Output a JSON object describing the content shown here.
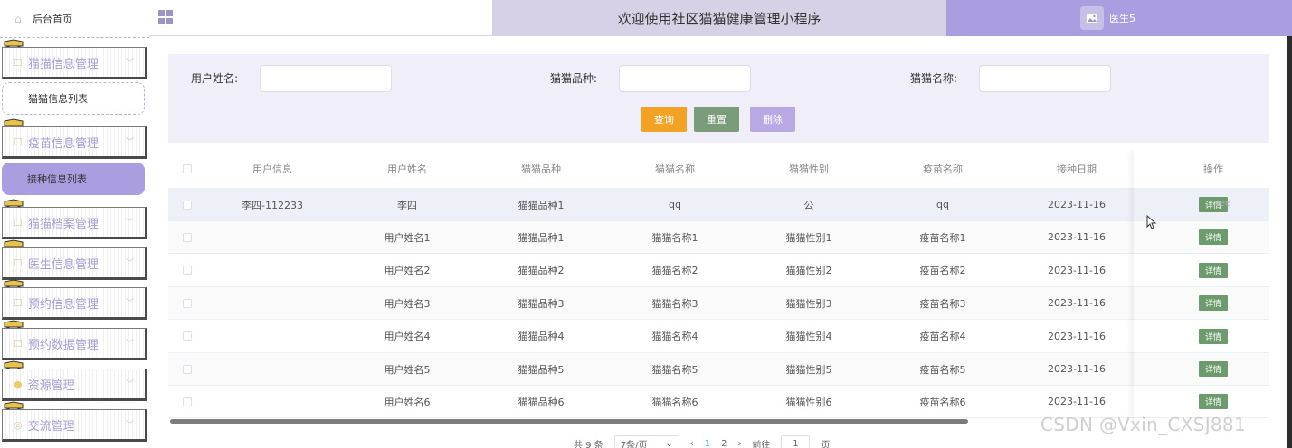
{
  "sidebar": {
    "home_label": "后台首页",
    "groups": [
      {
        "label": "猫猫信息管理"
      },
      {
        "label": "疫苗信息管理"
      },
      {
        "label": "猫猫档案管理"
      },
      {
        "label": "医生信息管理"
      },
      {
        "label": "预约信息管理"
      },
      {
        "label": "预约数据管理"
      },
      {
        "label": "资源管理"
      },
      {
        "label": "交流管理"
      }
    ],
    "sub_items": [
      {
        "label": "猫猫信息列表"
      },
      {
        "label": "接种信息列表"
      }
    ]
  },
  "header": {
    "title": "欢迎使用社区猫猫健康管理小程序",
    "user_name": "医生5"
  },
  "search": {
    "user_name_label": "用户姓名:",
    "breed_label": "猫猫品种:",
    "cat_name_label": "猫猫名称:",
    "user_name_value": "",
    "breed_value": "",
    "cat_name_value": "",
    "query_label": "查询",
    "reset_label": "重置",
    "delete_label": "删除"
  },
  "table": {
    "headers": [
      "用户信息",
      "用户姓名",
      "猫猫品种",
      "猫猫名称",
      "猫猫性别",
      "疫苗名称",
      "接种日期",
      "操作"
    ],
    "rows": [
      {
        "user_info": "李四-112233",
        "user_name": "李四",
        "breed": "猫猫品种1",
        "cat_name": "qq",
        "gender": "公",
        "vaccine": "qq",
        "date": "2023-11-16",
        "action": "详情"
      },
      {
        "user_info": "",
        "user_name": "用户姓名1",
        "breed": "猫猫品种1",
        "cat_name": "猫猫名称1",
        "gender": "猫猫性别1",
        "vaccine": "疫苗名称1",
        "date": "2023-11-16",
        "action": "详情"
      },
      {
        "user_info": "",
        "user_name": "用户姓名2",
        "breed": "猫猫品种2",
        "cat_name": "猫猫名称2",
        "gender": "猫猫性别2",
        "vaccine": "疫苗名称2",
        "date": "2023-11-16",
        "action": "详情"
      },
      {
        "user_info": "",
        "user_name": "用户姓名3",
        "breed": "猫猫品种3",
        "cat_name": "猫猫名称3",
        "gender": "猫猫性别3",
        "vaccine": "疫苗名称3",
        "date": "2023-11-16",
        "action": "详情"
      },
      {
        "user_info": "",
        "user_name": "用户姓名4",
        "breed": "猫猫品种4",
        "cat_name": "猫猫名称4",
        "gender": "猫猫性别4",
        "vaccine": "疫苗名称4",
        "date": "2023-11-16",
        "action": "详情"
      },
      {
        "user_info": "",
        "user_name": "用户姓名5",
        "breed": "猫猫品种5",
        "cat_name": "猫猫名称5",
        "gender": "猫猫性别5",
        "vaccine": "疫苗名称5",
        "date": "2023-11-16",
        "action": "详情"
      },
      {
        "user_info": "",
        "user_name": "用户姓名6",
        "breed": "猫猫品种6",
        "cat_name": "猫猫名称6",
        "gender": "猫猫性别6",
        "vaccine": "疫苗名称6",
        "date": "2023-11-16",
        "action": "详情"
      }
    ],
    "hover_ghost_text": "vee"
  },
  "pager": {
    "total": "共 9 条",
    "page_size": "7条/页",
    "prev": "‹",
    "pages": [
      "1",
      "2"
    ],
    "next": "›",
    "goto_prefix": "前往",
    "goto_value": "1",
    "goto_suffix": "页"
  },
  "watermark": "CSDN @Vxin_CXSJ881",
  "icons": {
    "home": "home-icon",
    "menu_grid": "grid-menu-icon",
    "avatar": "image-icon",
    "group": "document-icon",
    "chevron": "chevron-down-icon"
  },
  "colors": {
    "accent": "#aa9ee0",
    "title_bg": "#d6d1e5",
    "search_bg": "#f0eef8",
    "query_btn": "#f2a224",
    "reset_btn": "#7b9c7b",
    "delete_btn": "#b8a8e4",
    "detail_btn": "#6e9b6e"
  }
}
